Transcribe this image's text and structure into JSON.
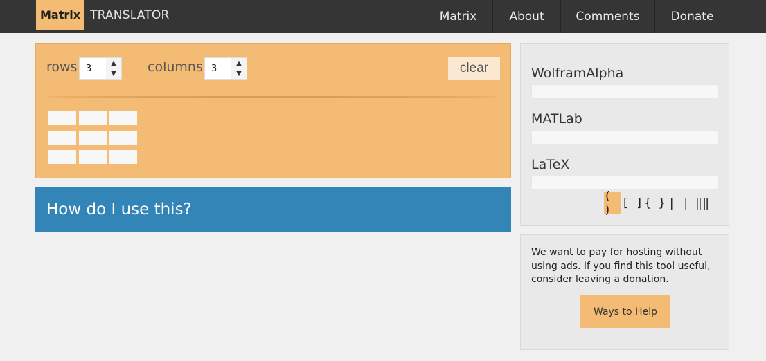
{
  "header": {
    "brand_box": "Matrix",
    "brand_text": "TRANSLATOR",
    "nav": [
      "Matrix",
      "About",
      "Comments",
      "Donate"
    ]
  },
  "controls": {
    "rows_label": "rows",
    "rows_value": "3",
    "columns_label": "columns",
    "columns_value": "3",
    "clear_label": "clear"
  },
  "matrix": {
    "rows": 3,
    "columns": 3
  },
  "help": {
    "title": "How do I use this?"
  },
  "outputs": {
    "wolfram_label": "WolframAlpha",
    "matlab_label": "MATLab",
    "latex_label": "LaTeX"
  },
  "brackets": {
    "items": [
      "( )",
      "[ ]",
      "{ }",
      "| |",
      "‖‖"
    ],
    "selected": "( )"
  },
  "donate": {
    "text": "We want to pay for hosting without using ads. If you find this tool useful, consider leaving a donation.",
    "button_label": "Ways to Help"
  },
  "colors": {
    "accent": "#f3bb74",
    "help_bar": "#3285b6",
    "topbar": "#353535"
  }
}
